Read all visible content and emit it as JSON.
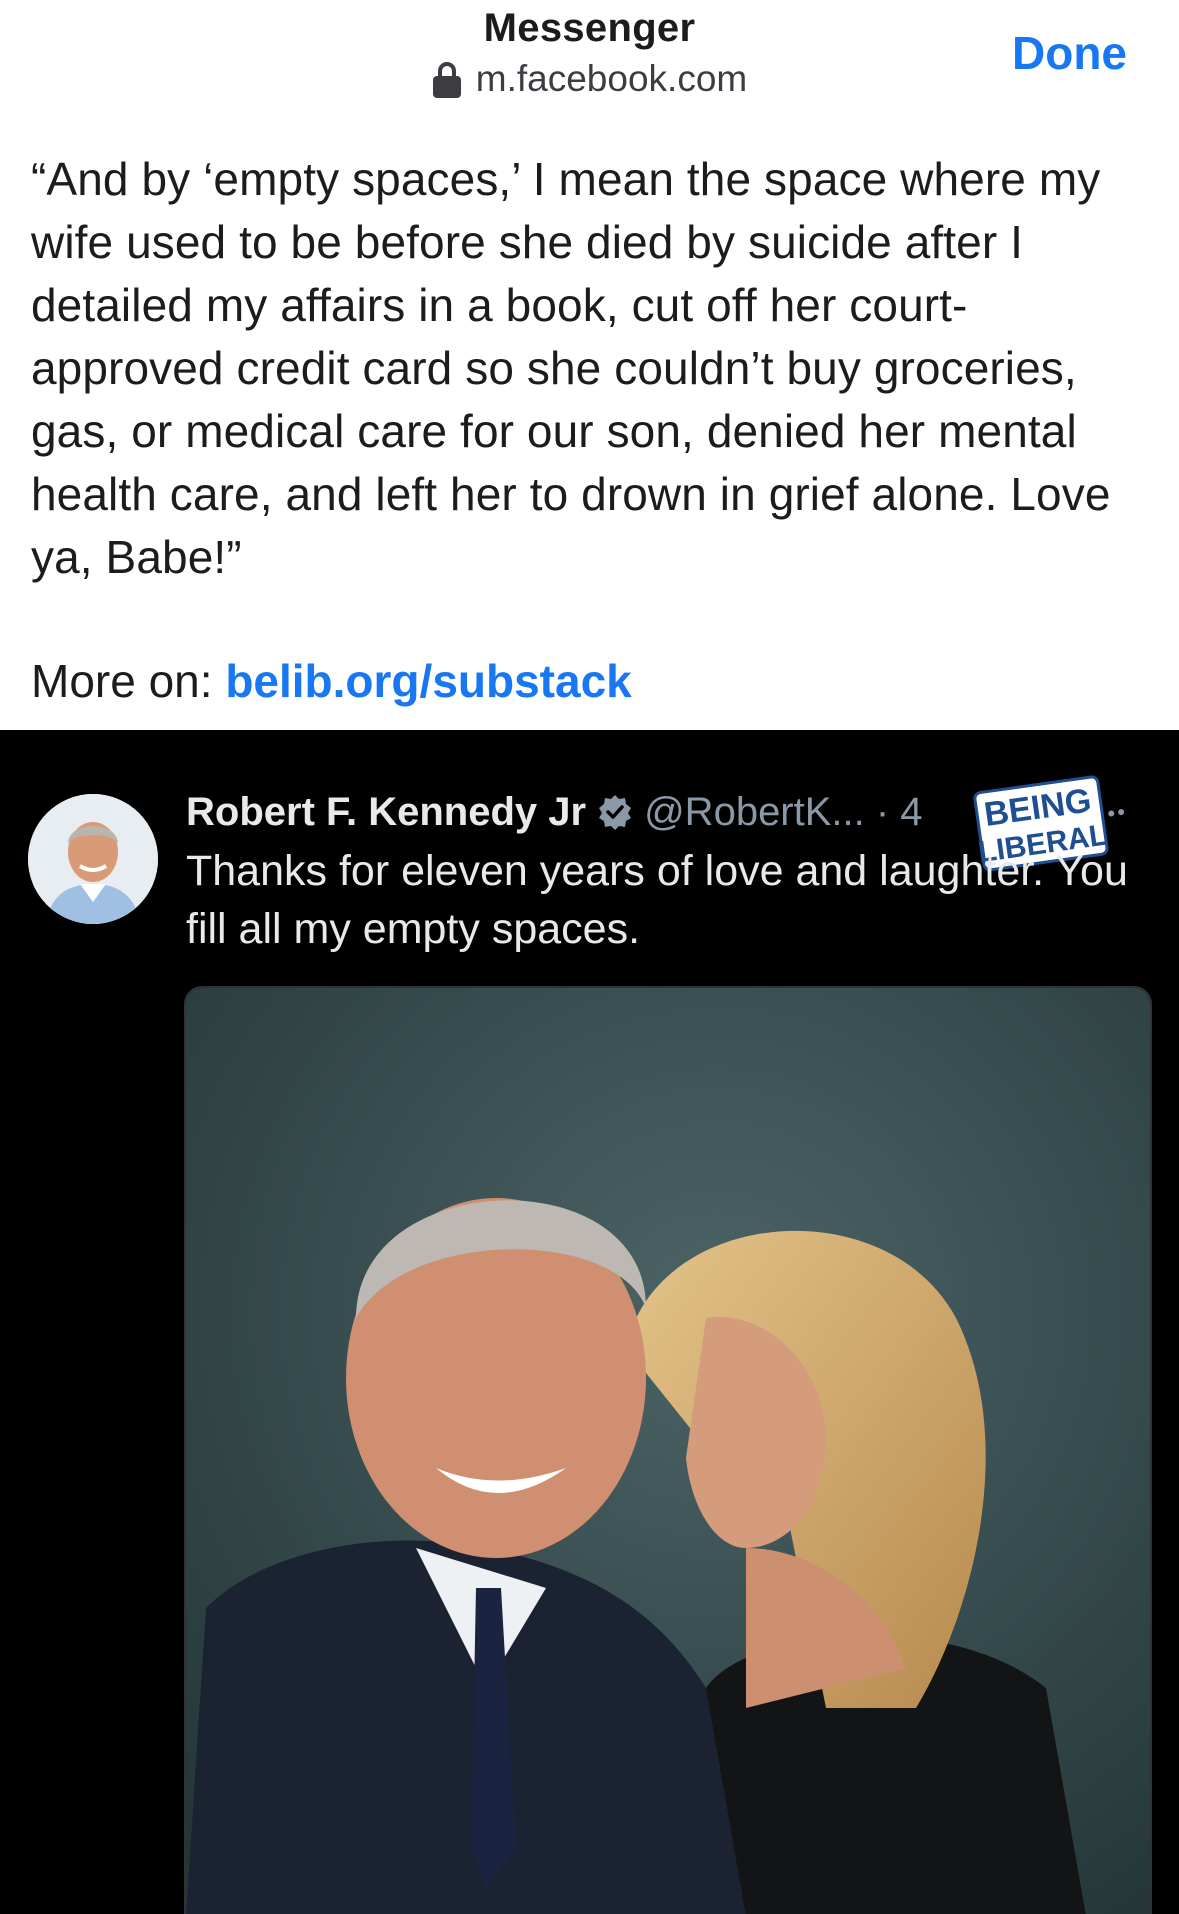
{
  "browser_header": {
    "app_title": "Messenger",
    "url": "m.facebook.com",
    "done_label": "Done",
    "lock_icon": "lock-icon"
  },
  "post": {
    "text": "“And by ‘empty spaces,’ I mean the space where my wife used to be before she died by suicide after I detailed my affairs in a book, cut off her court-approved credit card so she couldn’t buy groceries, gas, or medical care for our son, denied her mental health care, and left her to drown in grief alone. Love ya, Babe!”",
    "more_prefix": "More on: ",
    "more_link": "belib.org/substack"
  },
  "embedded_tweet": {
    "author_name": "Robert F. Kennedy Jr",
    "handle_and_time": "@RobertK... · 4",
    "text": "Thanks for eleven years of love and laughter. You fill all my empty spaces.",
    "verified_icon": "verified-badge-icon",
    "more_icon": "more-dots-icon",
    "watermark": [
      "BEING",
      "LIBERAL"
    ]
  },
  "colors": {
    "accent_blue": "#1877f2",
    "tweet_background": "#000000",
    "tweet_text": "#e7e9ea",
    "tweet_secondary": "#8b98a5"
  }
}
